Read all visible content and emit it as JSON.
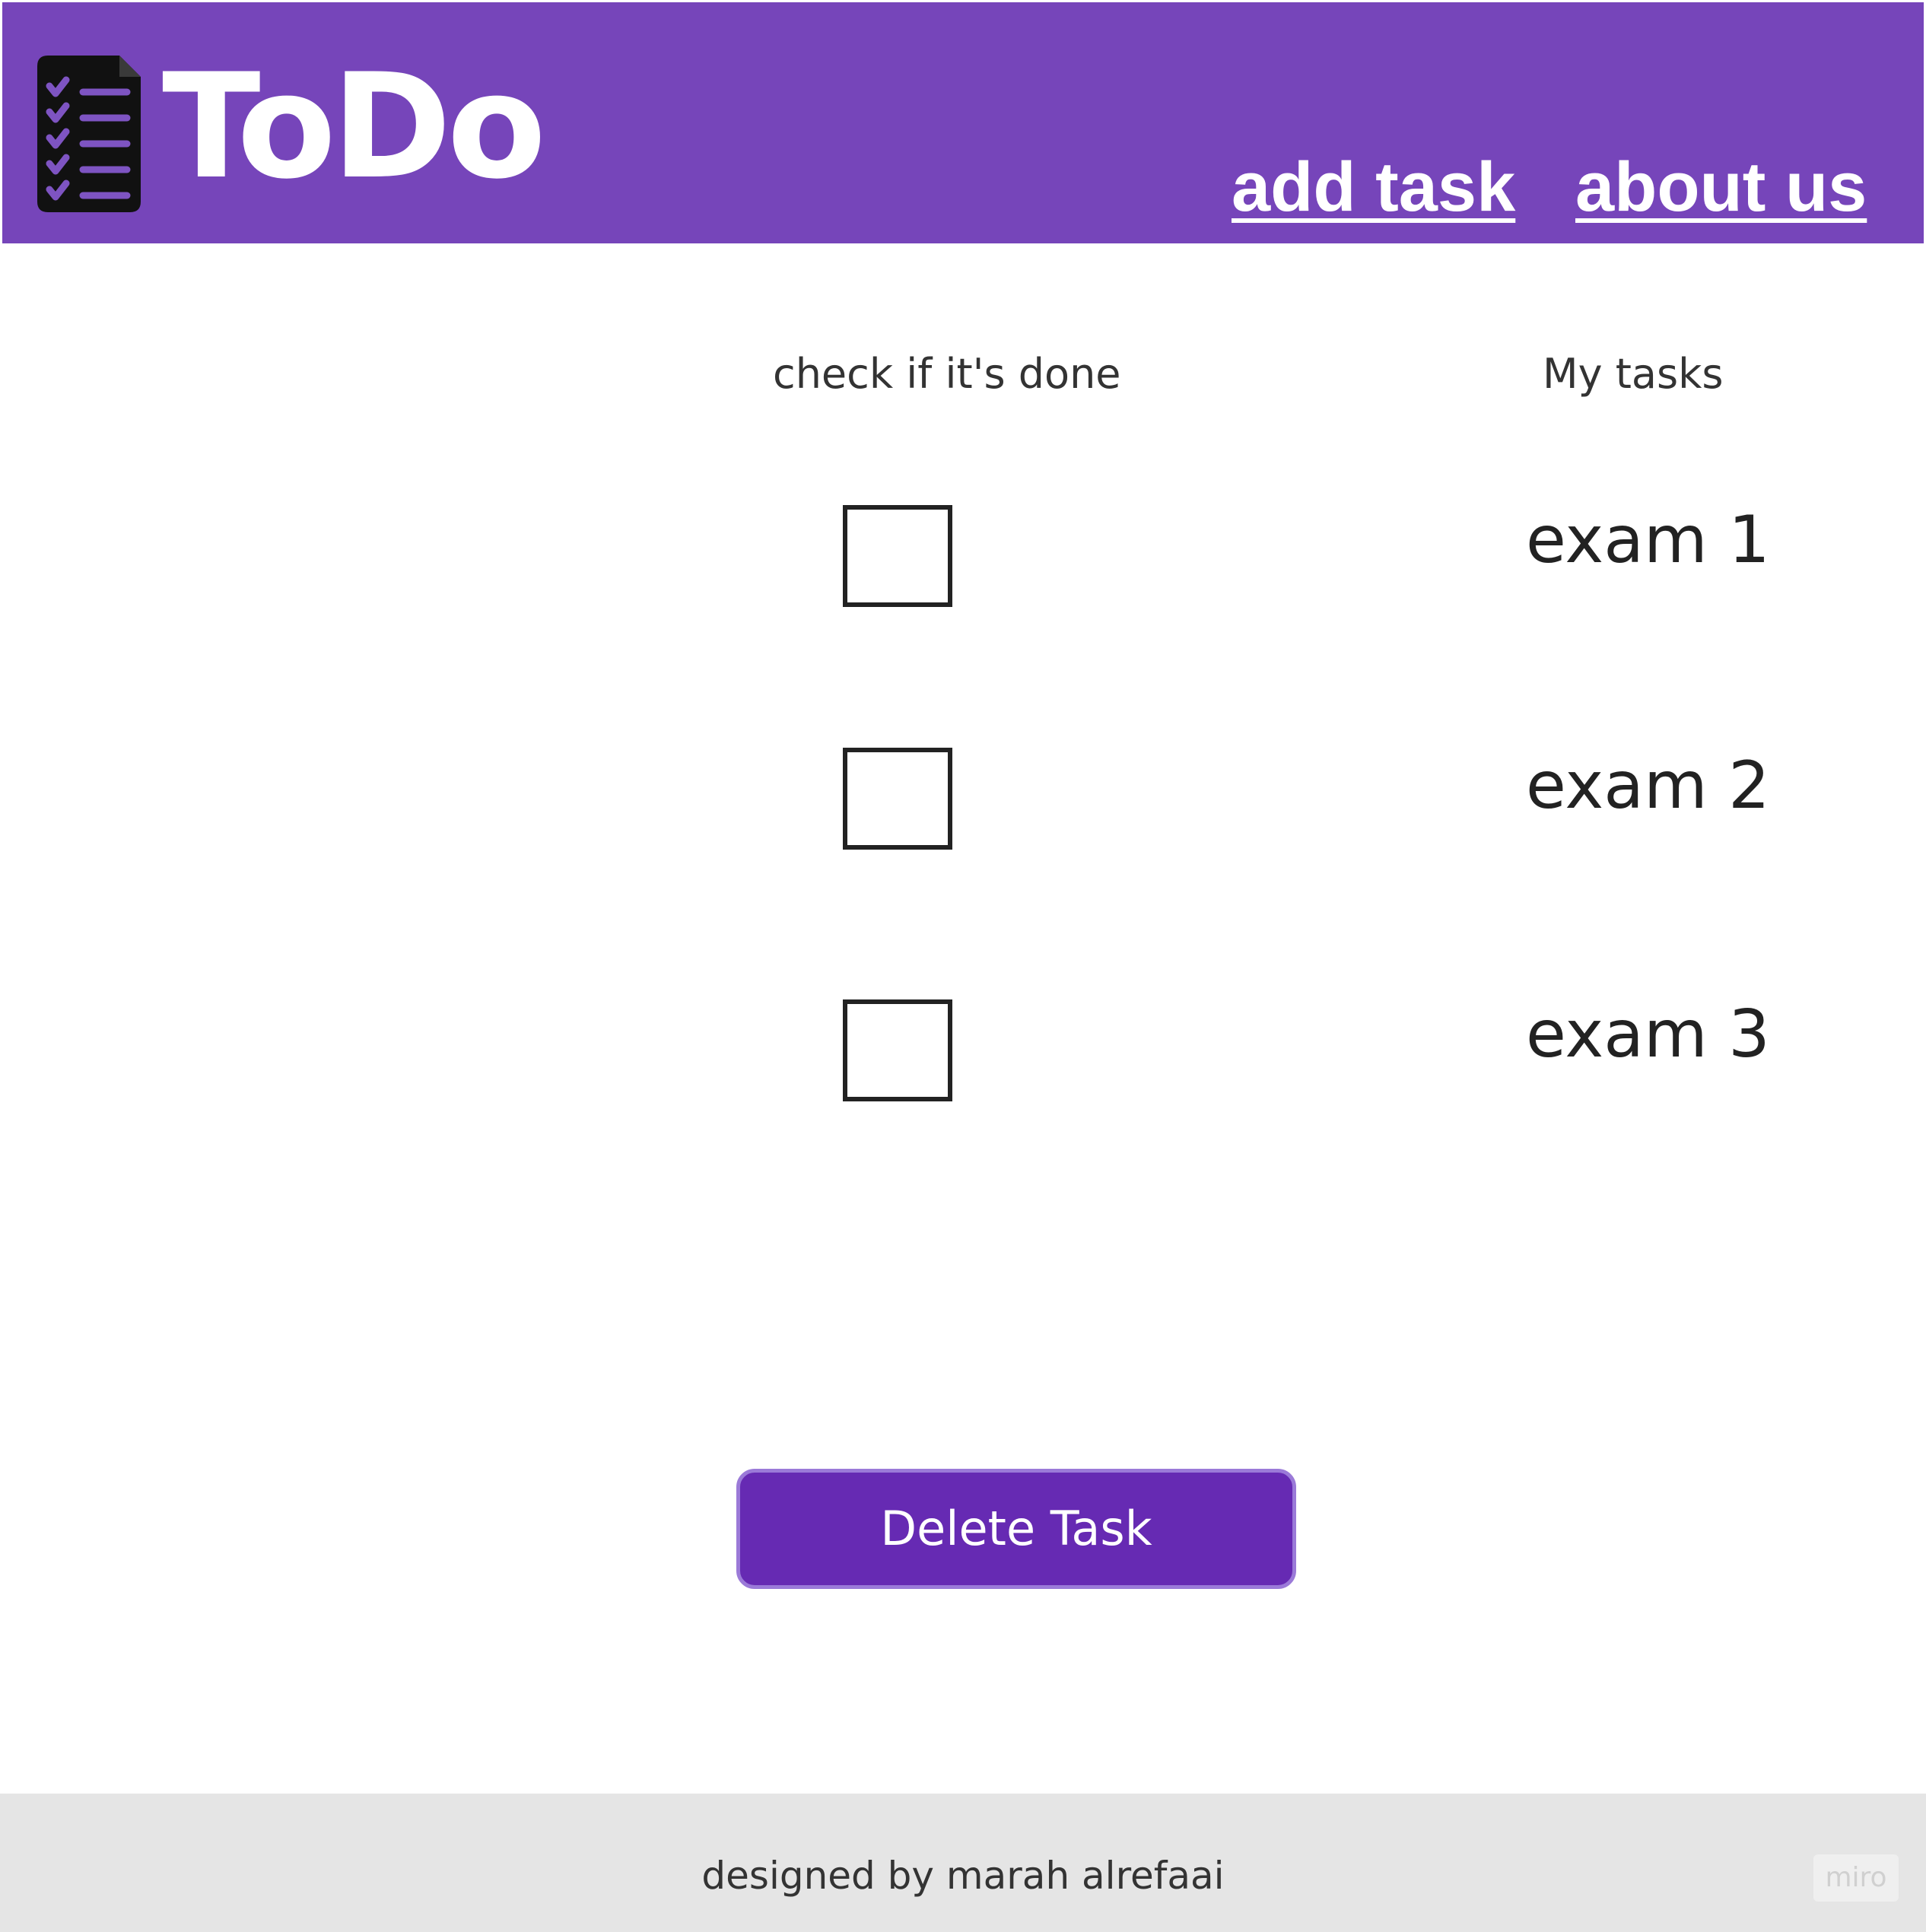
{
  "header": {
    "logo_text": "ToDo",
    "nav": {
      "add_task": "add task",
      "about_us": "about us"
    },
    "background_color": "#7645ba",
    "logo_icon": "checklist-document-icon"
  },
  "main": {
    "columns": {
      "check": "check if it's done",
      "tasks": "My tasks"
    },
    "tasks": [
      {
        "label": "exam 1",
        "checked": false
      },
      {
        "label": "exam 2",
        "checked": false
      },
      {
        "label": "exam 3",
        "checked": false
      }
    ],
    "delete_button": {
      "label": "Delete Task",
      "color": "#662ab3"
    }
  },
  "footer": {
    "credit": "designed by marah alrefaai",
    "watermark": "miro",
    "background_color": "#e5e5e5"
  }
}
